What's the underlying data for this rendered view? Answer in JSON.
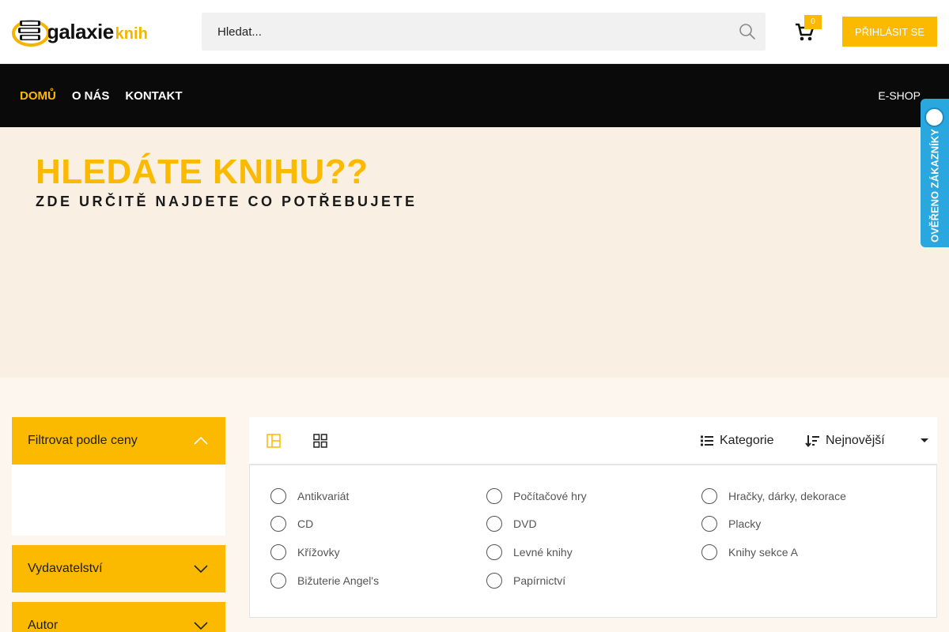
{
  "header": {
    "logo": {
      "main": "galaxie",
      "sub": "knih"
    },
    "search": {
      "placeholder": "Hledat..."
    },
    "cart": {
      "count": "0"
    },
    "login_label": "PŘIHLÁSIT SE"
  },
  "nav": {
    "items": [
      {
        "label": "DOMŮ",
        "active": true
      },
      {
        "label": "O NÁS",
        "active": false
      },
      {
        "label": "KONTAKT",
        "active": false
      }
    ],
    "eshop_label": "E-SHOP"
  },
  "hero": {
    "title": "HLEDÁTE KNIHU??",
    "subtitle": "ZDE URČITĚ NAJDETE CO POTŘEBUJETE"
  },
  "verified_badge": {
    "label": "OVĚŘENO ZÁKAZNÍKY"
  },
  "filters": [
    {
      "label": "Filtrovat podle ceny",
      "expanded": true
    },
    {
      "label": "Vydavatelství",
      "expanded": false
    },
    {
      "label": "Autor",
      "expanded": false
    }
  ],
  "toolbar": {
    "category_label": "Kategorie",
    "sort_label": "Nejnovější"
  },
  "categories": [
    [
      "Antikvariát",
      "CD",
      "Křížovky",
      "Bižuterie Angel's"
    ],
    [
      "Počítačové hry",
      "DVD",
      "Levné knihy",
      "Papírnictví"
    ],
    [
      "Hračky, dárky, dekorace",
      "Placky",
      "Knihy sekce A"
    ]
  ],
  "colors": {
    "accent": "#fbb900",
    "nav_bg": "#0a0a0a",
    "hero_bg": "#f9efe2",
    "verified_bg": "#2aa7df"
  }
}
